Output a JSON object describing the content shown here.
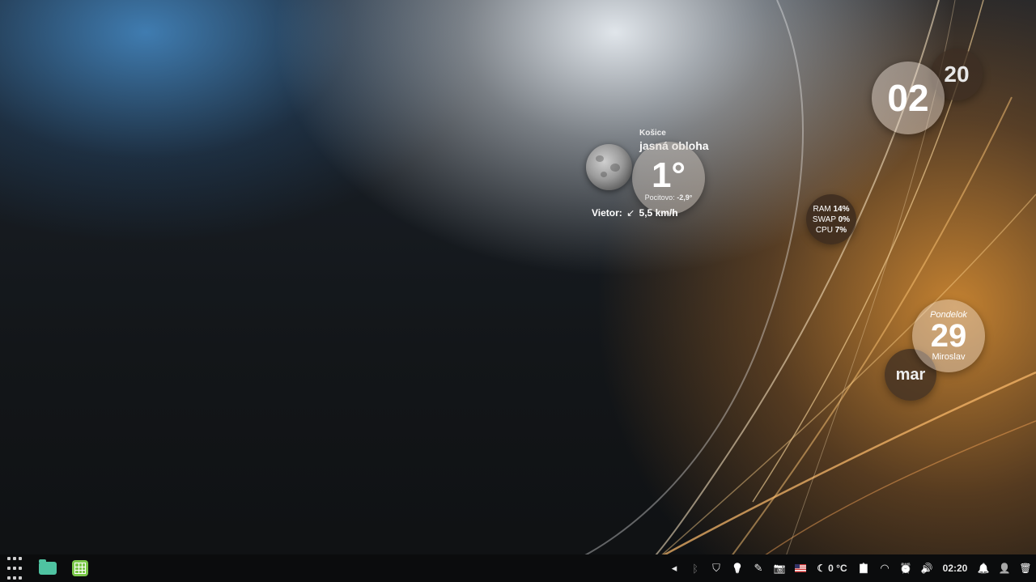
{
  "clock_widget": {
    "hour": "02",
    "minute": "20"
  },
  "weather": {
    "city": "Košice",
    "condition": "jasná obloha",
    "temperature": "1°",
    "feels_label": "Pocitovo:",
    "feels_value": "-2,9°",
    "wind_label": "Vietor:",
    "wind_arrow": "↙",
    "wind_value": "5,5 km/h",
    "icon": "moon-icon"
  },
  "system_monitor": {
    "ram_label": "RAM",
    "ram_value": "14%",
    "swap_label": "SWAP",
    "swap_value": "0%",
    "cpu_label": "CPU",
    "cpu_value": "7%"
  },
  "date_widget": {
    "weekday": "Pondelok",
    "day": "29",
    "nameday": "Miroslav",
    "month": "mar"
  },
  "taskbar": {
    "launchers": [
      {
        "name": "app-launcher-icon"
      },
      {
        "name": "file-manager-icon",
        "color": "#4fc3a1"
      },
      {
        "name": "spreadsheet-icon",
        "color": "#7cc84a"
      }
    ],
    "tray": {
      "expand_glyph": "◂",
      "bluetooth_glyph": "ᛒ",
      "shield_glyph": "⛉",
      "bulb_glyph": "💡",
      "notes_glyph": "✎",
      "camera_glyph": "📷",
      "weather_glyph": "☾",
      "temperature": "0 °C",
      "clipboard_glyph": "📋",
      "wifi_glyph": "◠",
      "alarm_glyph": "⏰",
      "volume_glyph": "🔊",
      "time": "02:20",
      "bell_glyph": "🔔",
      "user_glyph": "👤",
      "trash_glyph": "🗑"
    }
  }
}
